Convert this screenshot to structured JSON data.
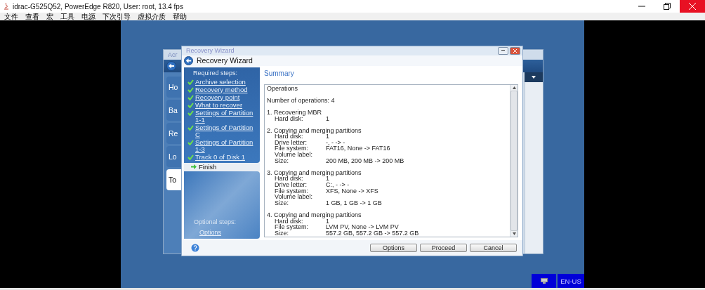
{
  "window": {
    "title": "idrac-G525Q52, PowerEdge R820, User: root, 13.4 fps"
  },
  "menu": [
    "文件",
    "查看",
    "宏",
    "工具",
    "电源",
    "下次引导",
    "虚拟介质",
    "帮助"
  ],
  "background_window": {
    "title": "Acr",
    "items": [
      {
        "label": "Ho",
        "selected": false
      },
      {
        "label": "Ba",
        "selected": false
      },
      {
        "label": "Re",
        "selected": false
      },
      {
        "label": "Lo",
        "selected": false
      },
      {
        "label": "To",
        "selected": true
      }
    ]
  },
  "wizard": {
    "title": "Recovery Wizard",
    "header": "Recovery Wizard",
    "required_heading": "Required steps:",
    "steps": [
      {
        "label": "Archive selection",
        "selected": false
      },
      {
        "label": "Recovery method",
        "selected": false
      },
      {
        "label": "Recovery point",
        "selected": false
      },
      {
        "label": "What to recover",
        "selected": false
      },
      {
        "label": "Settings of Partition 1-1",
        "selected": false
      },
      {
        "label": "Settings of Partition C",
        "selected": false
      },
      {
        "label": "Settings of Partition 1-3",
        "selected": false
      },
      {
        "label": "Track 0 of Disk 1",
        "selected": false
      },
      {
        "label": "Finish",
        "selected": true
      }
    ],
    "optional_heading": "Optional steps:",
    "optional_steps": [
      "Options"
    ],
    "section_title": "Summary",
    "summary": {
      "heading": "Operations",
      "count": "Number of operations: 4",
      "operations": [
        {
          "title": "1. Recovering MBR",
          "fields": [
            {
              "label": "Hard disk:",
              "value": "1"
            }
          ]
        },
        {
          "title": "2. Copying and merging partitions",
          "fields": [
            {
              "label": "Hard disk:",
              "value": "1"
            },
            {
              "label": "Drive letter:",
              "value": "-, - -> -"
            },
            {
              "label": "File system:",
              "value": "FAT16, None -> FAT16"
            },
            {
              "label": "Volume label:"
            },
            {
              "label": "Size:",
              "value": "200 MB, 200 MB -> 200 MB"
            }
          ]
        },
        {
          "title": "3. Copying and merging partitions",
          "fields": [
            {
              "label": "Hard disk:",
              "value": "1"
            },
            {
              "label": "Drive letter:",
              "value": "C:, - -> -"
            },
            {
              "label": "File system:",
              "value": "XFS, None -> XFS"
            },
            {
              "label": "Volume label:"
            },
            {
              "label": "Size:",
              "value": "1 GB, 1 GB -> 1 GB"
            }
          ]
        },
        {
          "title": "4. Copying and merging partitions",
          "fields": [
            {
              "label": "Hard disk:",
              "value": "1"
            },
            {
              "label": "File system:",
              "value": "LVM PV, None -> LVM PV"
            },
            {
              "label": "Size:",
              "value": "557.2 GB, 557.2 GB -> 557.2 GB"
            }
          ]
        }
      ]
    },
    "buttons": [
      "Options",
      "Proceed",
      "Cancel"
    ]
  },
  "taskbar": {
    "language": "EN-US"
  }
}
